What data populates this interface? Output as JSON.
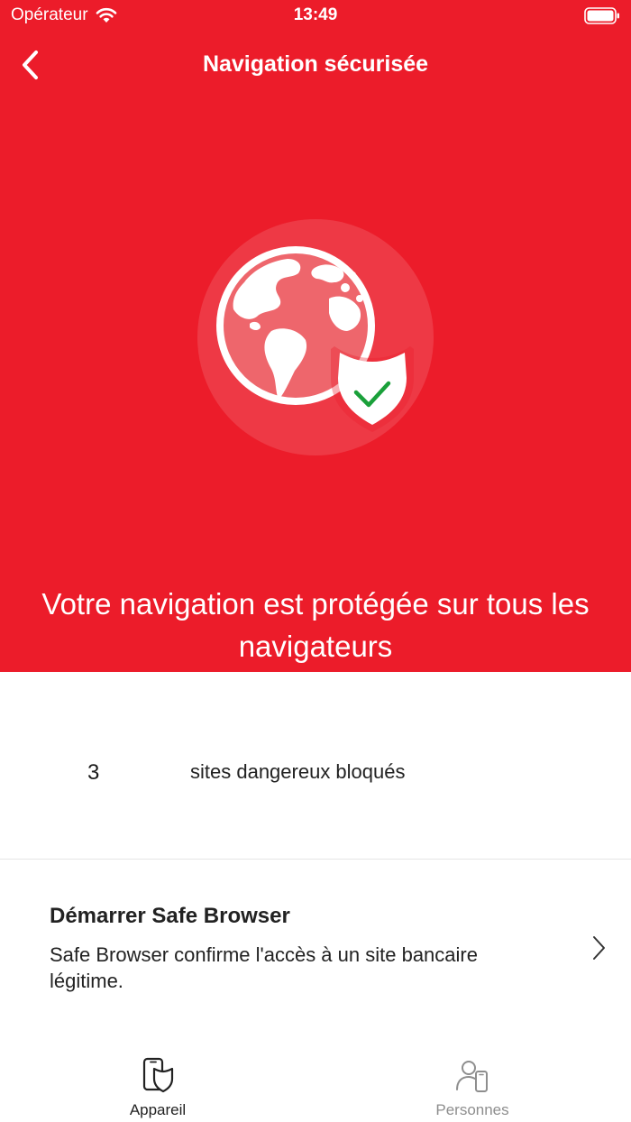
{
  "status_bar": {
    "carrier": "Opérateur",
    "time": "13:49"
  },
  "header": {
    "title": "Navigation sécurisée"
  },
  "hero": {
    "message": "Votre navigation est protégée sur tous les navigateurs",
    "accent_color": "#ec1c2a",
    "check_color": "#1aa03a"
  },
  "stats": {
    "count": "3",
    "label": "sites dangereux bloqués"
  },
  "safe_browser": {
    "title": "Démarrer Safe Browser",
    "description": "Safe Browser confirme l'accès à un site bancaire légitime."
  },
  "tabs": [
    {
      "label": "Appareil",
      "icon": "phone-shield-icon",
      "active": true
    },
    {
      "label": "Personnes",
      "icon": "person-phone-icon",
      "active": false
    }
  ]
}
